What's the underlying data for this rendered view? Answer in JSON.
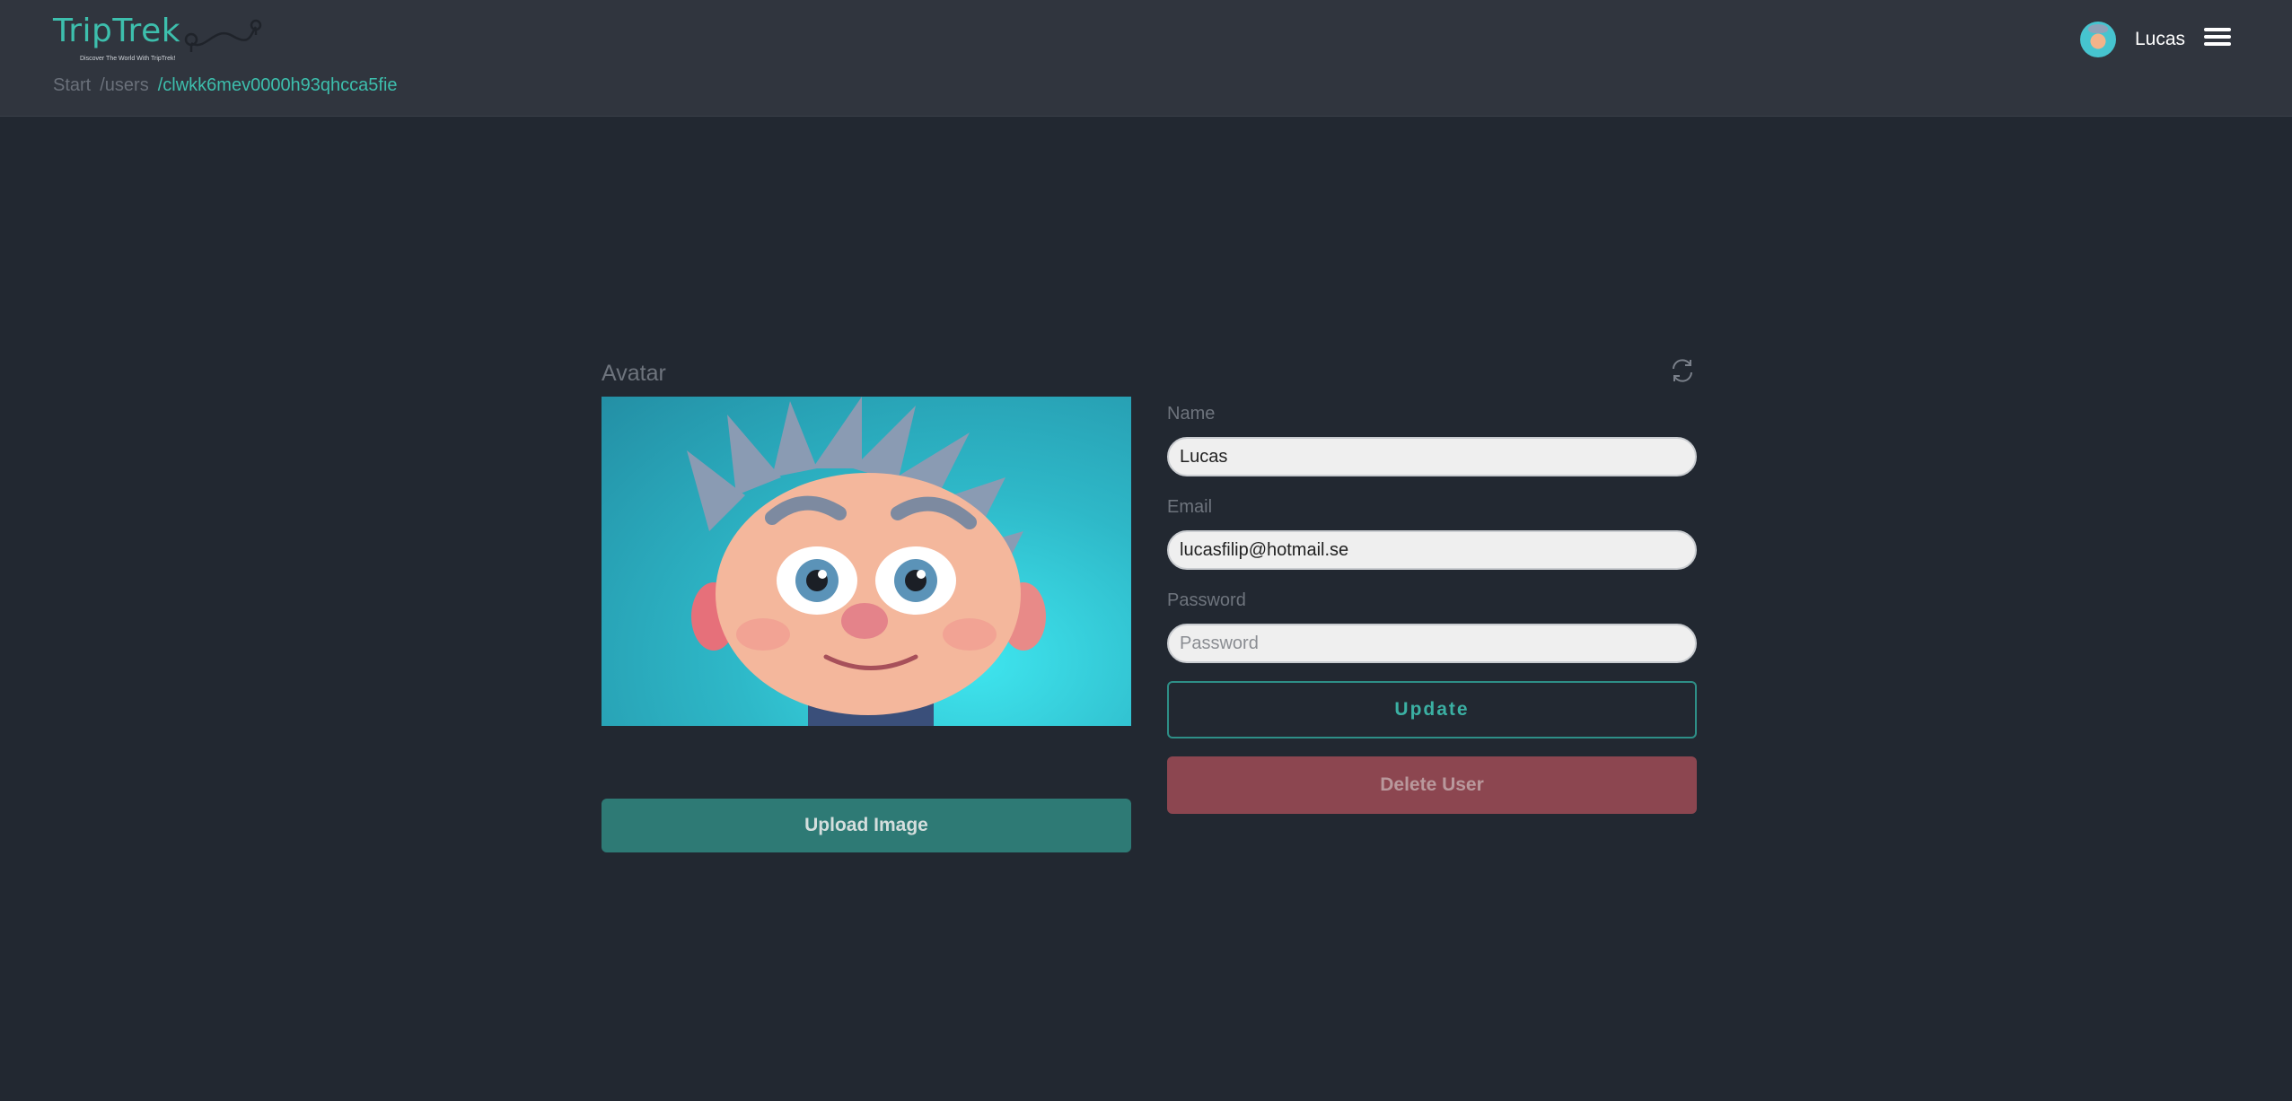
{
  "app": {
    "logo_title": "TripTrek",
    "logo_tagline": "Discover The World With TripTrek!",
    "accent_color": "#3dbfad"
  },
  "breadcrumb": {
    "items": [
      "Start",
      "/users"
    ],
    "current": "/clwkk6mev0000h93qhcca5fie"
  },
  "header": {
    "user_name": "Lucas",
    "menu_icon": "hamburger-menu-icon"
  },
  "avatar": {
    "label": "Avatar",
    "refresh_icon": "refresh-icon",
    "upload_label": "Upload Image"
  },
  "form": {
    "name_label": "Name",
    "name_value": "Lucas",
    "email_label": "Email",
    "email_value": "lucasfilip@hotmail.se",
    "password_label": "Password",
    "password_placeholder": "Password",
    "update_label": "Update",
    "delete_label": "Delete User"
  }
}
